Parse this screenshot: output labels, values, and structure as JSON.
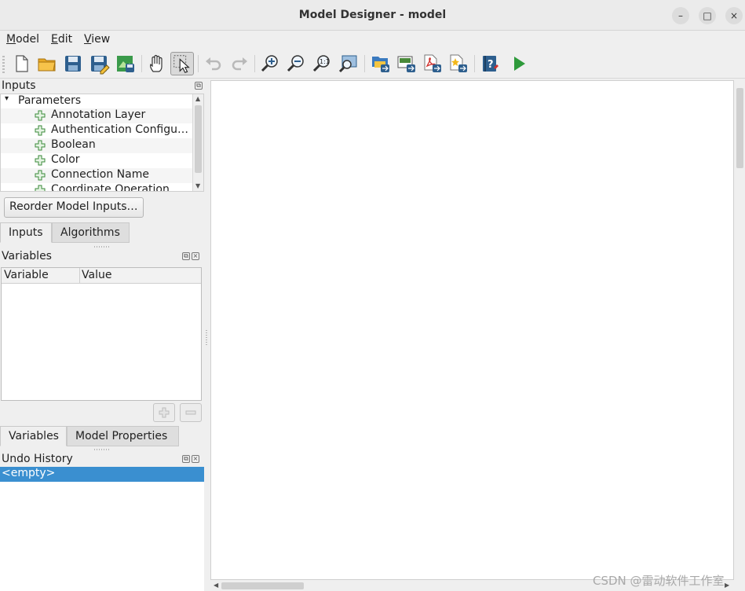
{
  "window": {
    "title": "Model Designer - model"
  },
  "window_controls": {
    "minimize": "–",
    "maximize": "□",
    "close": "×"
  },
  "menu": [
    {
      "label_ul": "M",
      "label_rest": "odel"
    },
    {
      "label_ul": "E",
      "label_rest": "dit"
    },
    {
      "label_ul": "V",
      "label_rest": "iew"
    }
  ],
  "toolbar_icons": [
    "new-model-icon",
    "open-model-icon",
    "save-icon",
    "save-as-icon",
    "save-to-project-icon",
    "pan-icon",
    "select-icon",
    "undo-icon",
    "redo-icon",
    "zoom-in-icon",
    "zoom-out-icon",
    "zoom-actual-icon",
    "zoom-full-icon",
    "export-image-icon",
    "export-svg-icon",
    "export-pdf-icon",
    "export-python-icon",
    "help-icon",
    "run-model-icon"
  ],
  "inputs_panel": {
    "title": "Inputs",
    "root_label": "Parameters",
    "items": [
      "Annotation Layer",
      "Authentication Configu…",
      "Boolean",
      "Color",
      "Connection Name",
      "Coordinate Operation"
    ],
    "reorder_button": "Reorder Model Inputs…",
    "tabs": [
      "Inputs",
      "Algorithms"
    ]
  },
  "variables_panel": {
    "title": "Variables",
    "columns": [
      "Variable",
      "Value"
    ],
    "tabs": [
      "Variables",
      "Model Properties"
    ]
  },
  "undo_panel": {
    "title": "Undo History",
    "items": [
      "<empty>"
    ]
  },
  "watermark": "CSDN @雷动软件工作室",
  "colors": {
    "accent": "#3a8fd0",
    "run": "#2e9a3b"
  }
}
